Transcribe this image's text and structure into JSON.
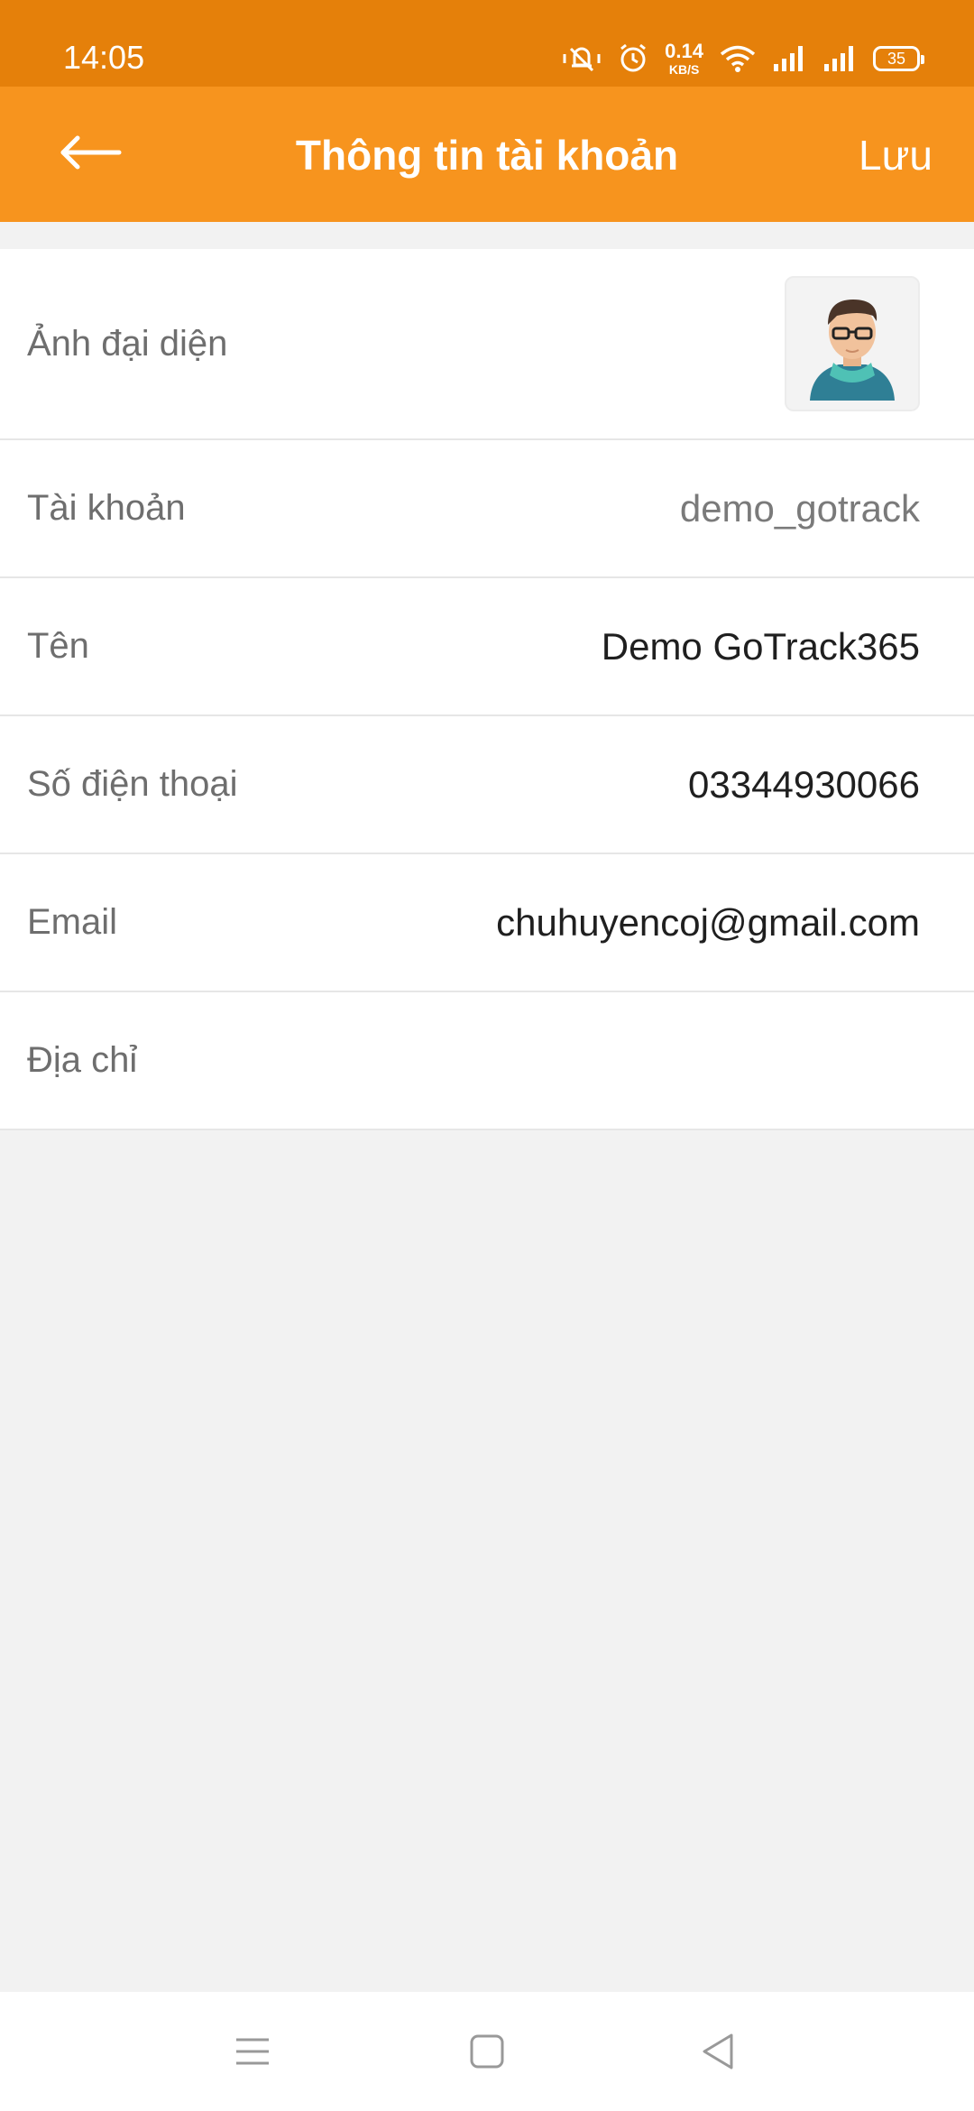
{
  "status_bar": {
    "time": "14:05",
    "net_speed_value": "0.14",
    "net_speed_unit": "KB/S",
    "battery": "35"
  },
  "app_bar": {
    "title": "Thông tin tài khoản",
    "save_label": "Lưu"
  },
  "profile": {
    "avatar_label": "Ảnh đại diện",
    "fields": [
      {
        "label": "Tài khoản",
        "value": "demo_gotrack"
      },
      {
        "label": "Tên",
        "value": "Demo GoTrack365"
      },
      {
        "label": "Số điện thoại",
        "value": "03344930066"
      },
      {
        "label": "Email",
        "value": "chuhuyencoj@gmail.com"
      },
      {
        "label": "Địa chỉ",
        "value": ""
      }
    ]
  },
  "colors": {
    "status_bar": "#e5800a",
    "app_bar": "#f7941e",
    "background": "#f2f2f2"
  },
  "icons": {
    "back": "arrow-left-icon",
    "menu": "menu-icon",
    "home": "home-square-icon",
    "nav_back": "triangle-back-icon"
  }
}
